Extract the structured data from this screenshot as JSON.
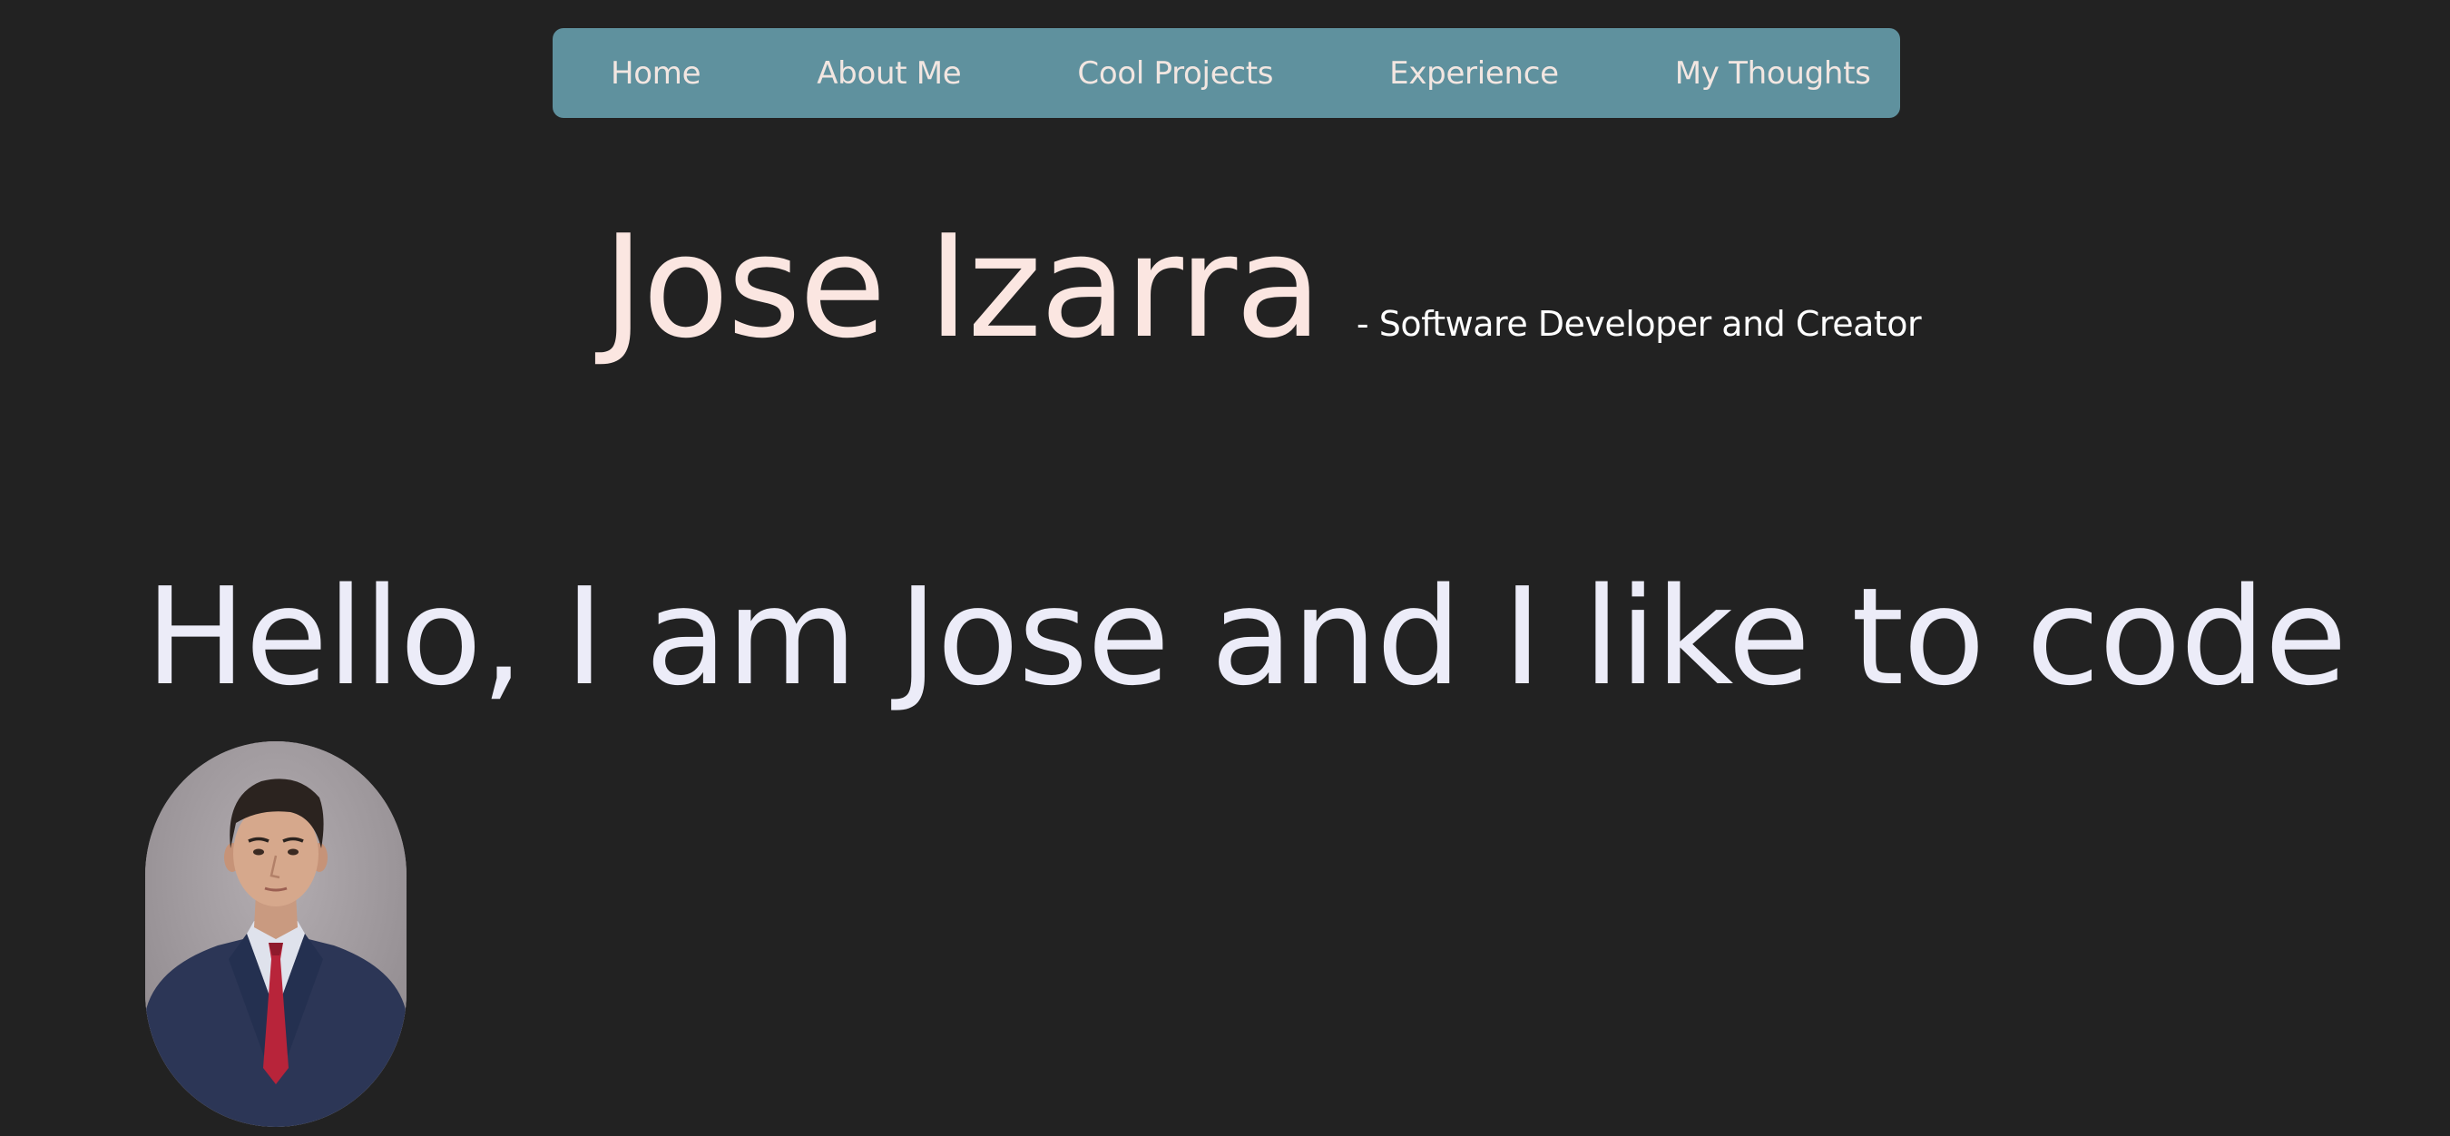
{
  "nav": {
    "items": [
      {
        "label": "Home"
      },
      {
        "label": "About Me"
      },
      {
        "label": "Cool Projects"
      },
      {
        "label": "Experience"
      },
      {
        "label": "My Thoughts"
      }
    ]
  },
  "header": {
    "name": "Jose Izarra",
    "tagline": "- Software Developer and Creator"
  },
  "hero": {
    "greeting": "Hello, I am Jose and I like to code"
  },
  "colors": {
    "background": "#222222",
    "nav_background": "#5f919e",
    "nav_text": "#f2e6e1",
    "name_text": "#fbe6e1",
    "greeting_text": "#ececf8"
  },
  "portrait": {
    "icon": "person-portrait-photo"
  }
}
